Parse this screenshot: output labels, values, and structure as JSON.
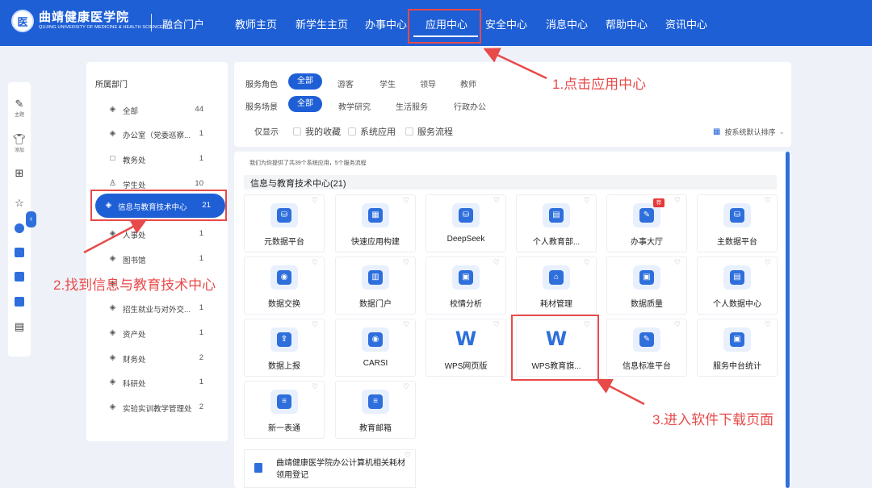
{
  "header": {
    "logo_mark": "医",
    "logo_cn": "曲靖健康医学院",
    "logo_en": "QUJING UNIVERSITY OF MEDICINE & HEALTH SCIENCES",
    "portal": "融合门户",
    "nav": [
      "教师主页",
      "新学生主页",
      "办事中心",
      "应用中心",
      "安全中心",
      "消息中心",
      "帮助中心",
      "资讯中心"
    ],
    "active_nav": "应用中心"
  },
  "toolbar": {
    "items": [
      {
        "icon": "edit-icon",
        "label": "主题"
      },
      {
        "icon": "shirt-icon",
        "label": "添加"
      }
    ]
  },
  "departments": {
    "title": "所属部门",
    "items": [
      {
        "label": "全部",
        "count": "44",
        "icon": "layers-icon"
      },
      {
        "label": "办公室（党委巡察...",
        "count": "1",
        "icon": "layers-icon"
      },
      {
        "label": "教务处",
        "count": "1",
        "icon": "book-icon"
      },
      {
        "label": "学生处",
        "count": "10",
        "icon": "users-icon"
      },
      {
        "label": "信息与教育技术中心",
        "count": "21",
        "icon": "layers-icon",
        "active": true
      },
      {
        "label": "人事处",
        "count": "1",
        "icon": "layers-icon"
      },
      {
        "label": "图书馆",
        "count": "1",
        "icon": "layers-icon"
      },
      {
        "label": "",
        "count": "",
        "icon": "layers-icon"
      },
      {
        "label": "招生就业与对外交...",
        "count": "1",
        "icon": "layers-icon"
      },
      {
        "label": "资产处",
        "count": "1",
        "icon": "layers-icon"
      },
      {
        "label": "财务处",
        "count": "2",
        "icon": "layers-icon"
      },
      {
        "label": "科研处",
        "count": "1",
        "icon": "layers-icon"
      },
      {
        "label": "实验实训教学管理处",
        "count": "2",
        "icon": "layers-icon"
      }
    ]
  },
  "filters": {
    "role_label": "服务角色",
    "roles": [
      "全部",
      "游客",
      "学生",
      "领导",
      "教师"
    ],
    "scene_label": "服务场景",
    "scenes": [
      "全部",
      "教学研究",
      "生活服务",
      "行政办公"
    ],
    "only_label": "仅显示",
    "checks": [
      "我的收藏",
      "系统应用",
      "服务流程"
    ],
    "sort": "按系统默认排序"
  },
  "main": {
    "summary": "我们为你提供了共39个系统应用，5个服务流程",
    "group_title": "信息与教育技术中心(21)",
    "apps": [
      {
        "name": "元数据平台",
        "glyph": "⛁"
      },
      {
        "name": "快速应用构建",
        "glyph": "▦"
      },
      {
        "name": "DeepSeek",
        "glyph": "⛁"
      },
      {
        "name": "个人教育部...",
        "glyph": "▤"
      },
      {
        "name": "办事大厅",
        "glyph": "✎",
        "badge": "荐"
      },
      {
        "name": "主数据平台",
        "glyph": "⛁"
      },
      {
        "name": "数据交换",
        "glyph": "◉"
      },
      {
        "name": "数据门户",
        "glyph": "▥"
      },
      {
        "name": "校情分析",
        "glyph": "▣"
      },
      {
        "name": "耗材管理",
        "glyph": "⌂"
      },
      {
        "name": "数据质量",
        "glyph": "▣"
      },
      {
        "name": "个人数据中心",
        "glyph": "▤"
      },
      {
        "name": "数据上报",
        "glyph": "⇪"
      },
      {
        "name": "CARSI",
        "glyph": "◉"
      },
      {
        "name": "WPS网页版",
        "glyph": "W",
        "wps": true
      },
      {
        "name": "WPS教育旗...",
        "glyph": "W",
        "wps": true
      },
      {
        "name": "信息标准平台",
        "glyph": "✎"
      },
      {
        "name": "服务中台统计",
        "glyph": "▣"
      },
      {
        "name": "新一表通",
        "glyph": "≡"
      },
      {
        "name": "教育邮箱",
        "glyph": "≡"
      }
    ],
    "process": "曲靖健康医学院办公计算机相关耗材领用登记"
  },
  "annotations": {
    "step1": "1.点击应用中心",
    "step2": "2.找到信息与教育技术中心",
    "step3": "3.进入软件下载页面"
  },
  "colors": {
    "primary": "#1e5fd6",
    "annotation": "#e84a4a"
  }
}
